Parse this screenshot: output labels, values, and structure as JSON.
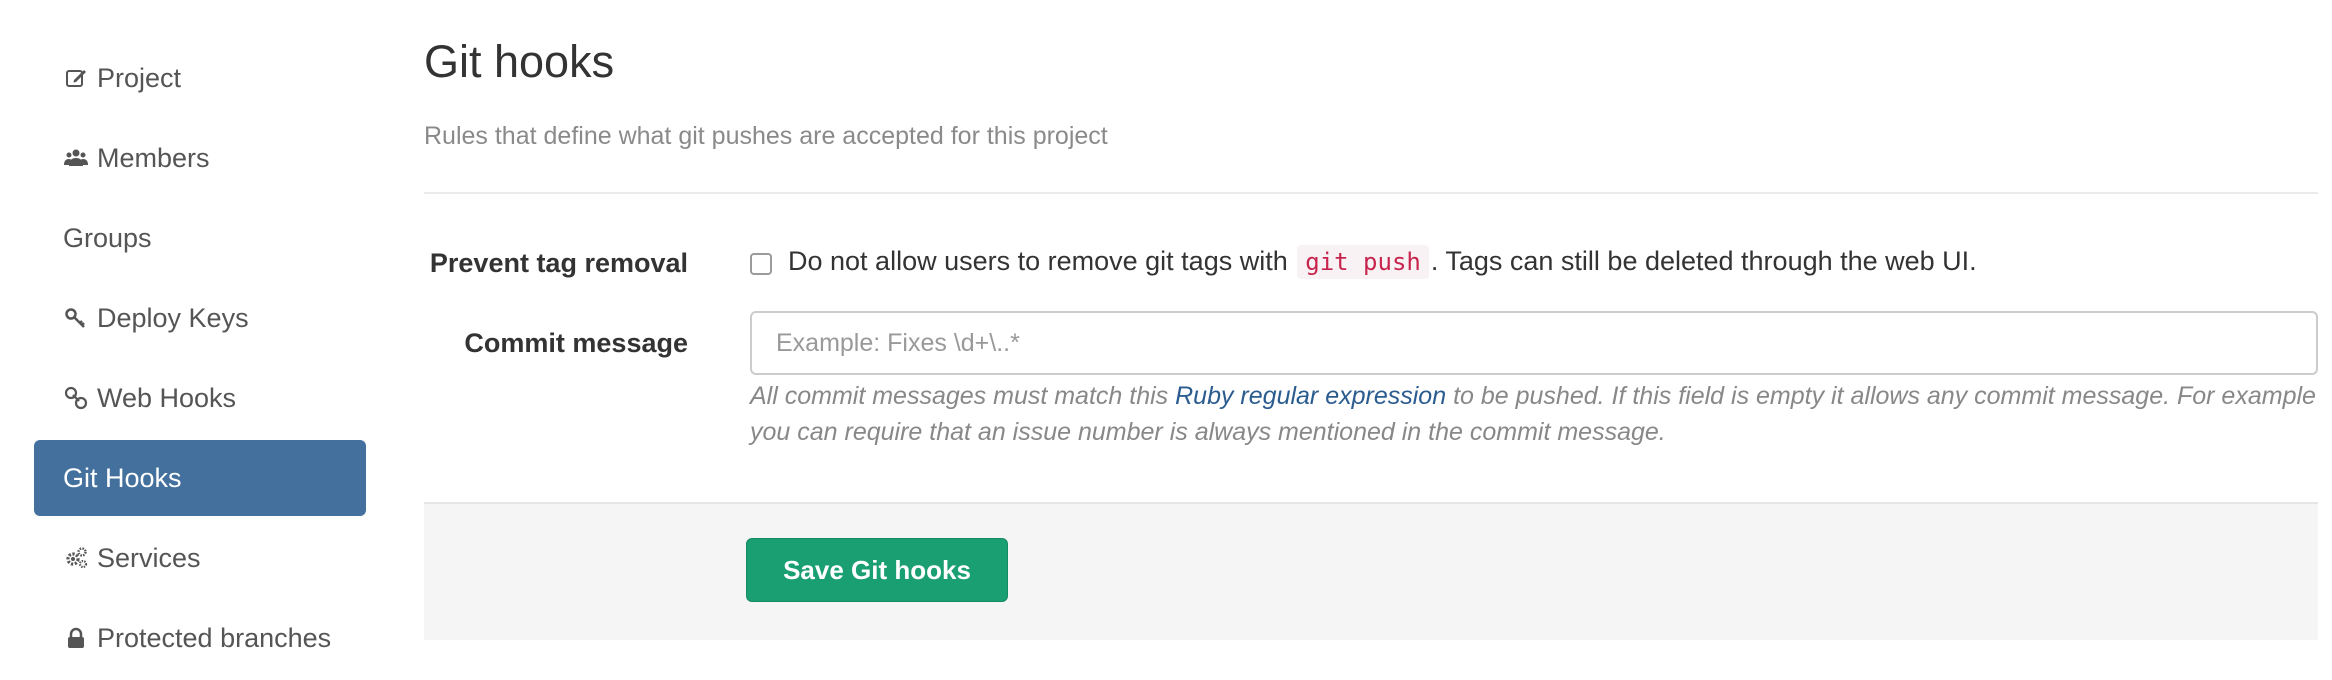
{
  "sidebar": {
    "items": [
      {
        "label": "Project",
        "icon": "edit-icon"
      },
      {
        "label": "Members",
        "icon": "users-icon"
      },
      {
        "label": "Groups",
        "icon": ""
      },
      {
        "label": "Deploy Keys",
        "icon": "key-icon"
      },
      {
        "label": "Web Hooks",
        "icon": "link-icon"
      },
      {
        "label": "Git Hooks",
        "icon": "",
        "active": true
      },
      {
        "label": "Services",
        "icon": "gears-icon"
      },
      {
        "label": "Protected branches",
        "icon": "lock-icon"
      }
    ],
    "active_color": "#44709d"
  },
  "main": {
    "title": "Git hooks",
    "subtitle": "Rules that define what git pushes are accepted for this project",
    "prevent_tag": {
      "label": "Prevent tag removal",
      "text_before": "Do not allow users to remove git tags with",
      "code": "git push",
      "text_after": ". Tags can still be deleted through the web UI.",
      "checked": false
    },
    "commit_message": {
      "label": "Commit message",
      "value": "",
      "placeholder": "Example: Fixes \\d+\\..*",
      "help_before": "All commit messages must match this",
      "help_link": "Ruby regular expression",
      "help_after": "to be pushed. If this field is empty it allows any commit message. For example you can require that an issue number is always mentioned in the commit message."
    },
    "save_button": {
      "label": "Save Git hooks",
      "color": "#1a9f72"
    }
  }
}
